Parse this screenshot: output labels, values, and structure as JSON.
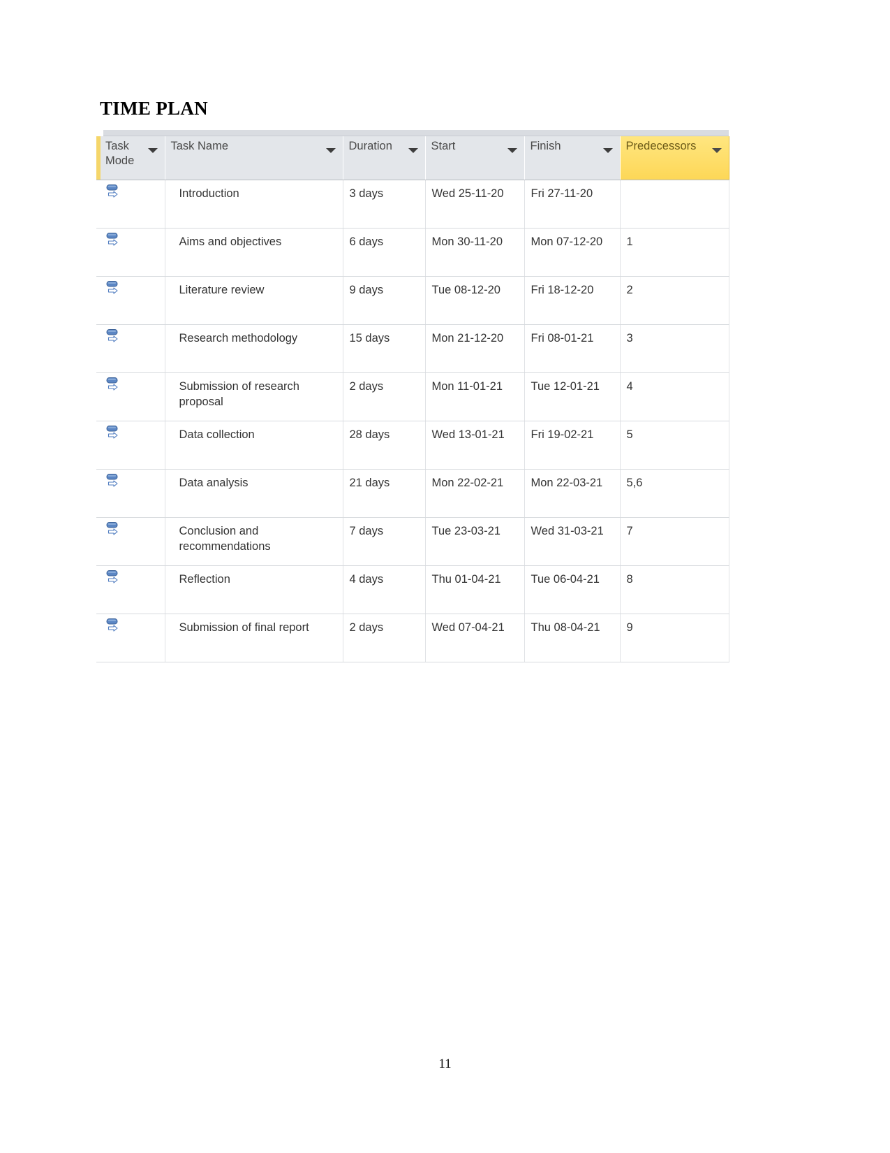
{
  "page": {
    "title": "TIME PLAN",
    "number": "11"
  },
  "colors": {
    "header_background": "#e3e6ea",
    "predecessors_header_background": "#fde272",
    "accent_stripe": "#f5d66a",
    "grid_line": "#d7dade",
    "task_mode_icon_blue": "#4e7bbf"
  },
  "table": {
    "columns": [
      {
        "key": "task_mode",
        "label": "Task Mode",
        "icon": "filter-caret-icon",
        "highlighted": false
      },
      {
        "key": "task_name",
        "label": "Task Name",
        "icon": "filter-caret-icon",
        "highlighted": false
      },
      {
        "key": "duration",
        "label": "Duration",
        "icon": "filter-caret-icon",
        "highlighted": false
      },
      {
        "key": "start",
        "label": "Start",
        "icon": "filter-caret-icon",
        "highlighted": false
      },
      {
        "key": "finish",
        "label": "Finish",
        "icon": "filter-caret-icon",
        "highlighted": false
      },
      {
        "key": "predecessors",
        "label": "Predecessors",
        "icon": "filter-caret-icon",
        "highlighted": true
      }
    ],
    "rows": [
      {
        "task_mode_icon": "auto-scheduled-icon",
        "task_name": "Introduction",
        "duration": "3 days",
        "start": "Wed 25-11-20",
        "finish": "Fri 27-11-20",
        "predecessors": ""
      },
      {
        "task_mode_icon": "auto-scheduled-icon",
        "task_name": "Aims and objectives",
        "duration": "6 days",
        "start": "Mon 30-11-20",
        "finish": "Mon 07-12-20",
        "predecessors": "1"
      },
      {
        "task_mode_icon": "auto-scheduled-icon",
        "task_name": "Literature review",
        "duration": "9 days",
        "start": "Tue 08-12-20",
        "finish": "Fri 18-12-20",
        "predecessors": "2"
      },
      {
        "task_mode_icon": "auto-scheduled-icon",
        "task_name": "Research methodology",
        "duration": "15 days",
        "start": "Mon 21-12-20",
        "finish": "Fri 08-01-21",
        "predecessors": "3"
      },
      {
        "task_mode_icon": "auto-scheduled-icon",
        "task_name": "Submission of research proposal",
        "duration": "2 days",
        "start": "Mon 11-01-21",
        "finish": "Tue 12-01-21",
        "predecessors": "4"
      },
      {
        "task_mode_icon": "auto-scheduled-icon",
        "task_name": "Data collection",
        "duration": "28 days",
        "start": "Wed 13-01-21",
        "finish": "Fri 19-02-21",
        "predecessors": "5"
      },
      {
        "task_mode_icon": "auto-scheduled-icon",
        "task_name": "Data analysis",
        "duration": "21 days",
        "start": "Mon 22-02-21",
        "finish": "Mon 22-03-21",
        "predecessors": "5,6"
      },
      {
        "task_mode_icon": "auto-scheduled-icon",
        "task_name": "Conclusion and recommendations",
        "duration": "7 days",
        "start": "Tue 23-03-21",
        "finish": "Wed 31-03-21",
        "predecessors": "7"
      },
      {
        "task_mode_icon": "auto-scheduled-icon",
        "task_name": "Reflection",
        "duration": "4 days",
        "start": "Thu 01-04-21",
        "finish": "Tue 06-04-21",
        "predecessors": "8"
      },
      {
        "task_mode_icon": "auto-scheduled-icon",
        "task_name": "Submission of final report",
        "duration": "2 days",
        "start": "Wed 07-04-21",
        "finish": "Thu 08-04-21",
        "predecessors": "9"
      }
    ]
  }
}
